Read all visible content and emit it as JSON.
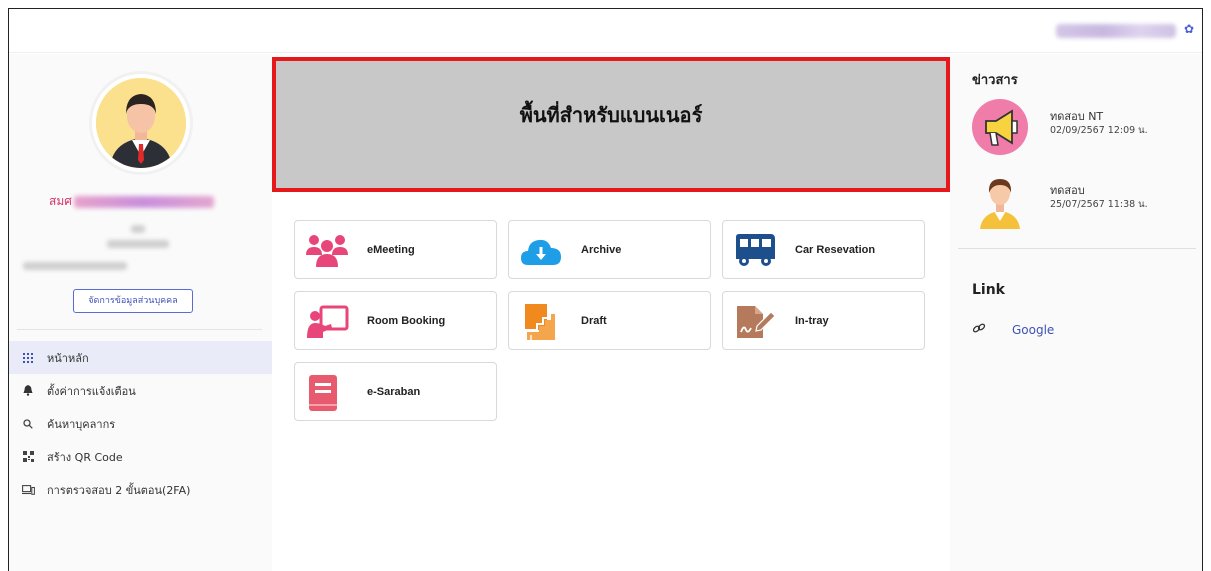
{
  "header": {
    "user_name_blurred": "",
    "settings_icon": "gear-icon"
  },
  "sidebar": {
    "profile": {
      "name_prefix": "สมศ",
      "manage_button_label": "จัดการข้อมูลส่วนบุคคล"
    },
    "menu": [
      {
        "label": "หน้าหลัก",
        "icon": "grid-icon",
        "active": true
      },
      {
        "label": "ตั้งค่าการแจ้งเตือน",
        "icon": "bell-icon",
        "active": false
      },
      {
        "label": "ค้นหาบุคลากร",
        "icon": "search-icon",
        "active": false
      },
      {
        "label": "สร้าง QR Code",
        "icon": "qr-code-icon",
        "active": false
      },
      {
        "label": "การตรวจสอบ 2 ขั้นตอน(2FA)",
        "icon": "device-icon",
        "active": false
      }
    ]
  },
  "main": {
    "banner_text": "พื้นที่สำหรับแบนเนอร์",
    "apps": [
      {
        "label": "eMeeting",
        "icon": "people-icon"
      },
      {
        "label": "Archive",
        "icon": "cloud-download-icon"
      },
      {
        "label": "Car Resevation",
        "icon": "bus-icon"
      },
      {
        "label": "Room Booking",
        "icon": "presentation-icon"
      },
      {
        "label": "Draft",
        "icon": "draft-icon"
      },
      {
        "label": "In-tray",
        "icon": "signature-icon"
      },
      {
        "label": "e-Saraban",
        "icon": "book-icon"
      }
    ]
  },
  "right": {
    "news_title": "ข่าวสาร",
    "news": [
      {
        "title": "ทดสอบ NT",
        "date": "02/09/2567 12:09 น.",
        "icon": "megaphone-icon"
      },
      {
        "title": "ทดสอบ",
        "date": "25/07/2567 11:38 น.",
        "icon": "person-avatar-icon"
      }
    ],
    "link_title": "Link",
    "links": [
      {
        "label": "Google",
        "icon": "link-icon"
      }
    ]
  },
  "colors": {
    "accent": "#3f51b5",
    "banner_border": "#e5191c",
    "banner_bg": "#c8c8c8",
    "menu_active_bg": "#e9ecf8"
  }
}
